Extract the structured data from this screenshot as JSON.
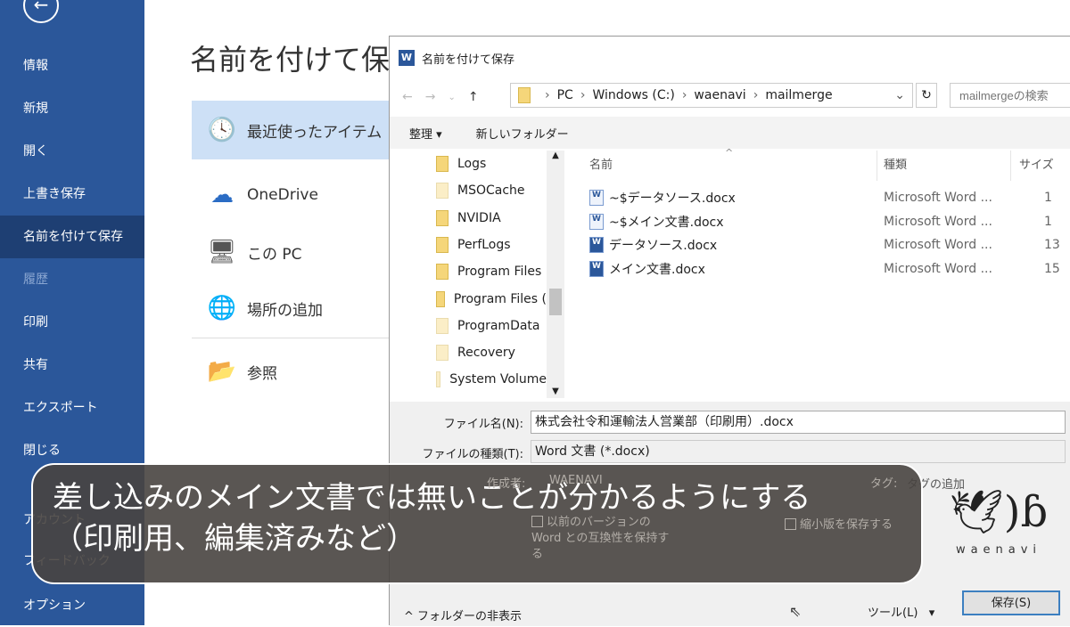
{
  "backstage": {
    "nav": [
      {
        "label": "情報"
      },
      {
        "label": "新規"
      },
      {
        "label": "開く"
      },
      {
        "label": "上書き保存"
      },
      {
        "label": "名前を付けて保存",
        "selected": true
      },
      {
        "label": "履歴",
        "disabled": true
      },
      {
        "label": "印刷"
      },
      {
        "label": "共有"
      },
      {
        "label": "エクスポート"
      },
      {
        "label": "閉じる"
      },
      {
        "label": "アカウント"
      },
      {
        "label": "フィードバック"
      },
      {
        "label": "オプション"
      }
    ],
    "title": "名前を付けて保存",
    "locations": [
      {
        "label": "最近使ったアイテム",
        "icon": "clock-icon"
      },
      {
        "label": "OneDrive",
        "icon": "cloud-icon"
      },
      {
        "label": "この PC",
        "icon": "computer-icon"
      },
      {
        "label": "場所の追加",
        "icon": "globe-add-icon"
      },
      {
        "label": "参照",
        "icon": "folder-open-icon"
      }
    ]
  },
  "dialog": {
    "title": "名前を付けて保存",
    "breadcrumb": [
      "PC",
      "Windows (C:)",
      "waenavi",
      "mailmerge"
    ],
    "search_placeholder": "mailmergeの検索",
    "toolbar": {
      "organize": "整理 ▾",
      "new_folder": "新しいフォルダー"
    },
    "tree": [
      {
        "name": "Logs"
      },
      {
        "name": "MSOCache",
        "pale": true
      },
      {
        "name": "NVIDIA"
      },
      {
        "name": "PerfLogs"
      },
      {
        "name": "Program Files"
      },
      {
        "name": "Program Files ("
      },
      {
        "name": "ProgramData",
        "pale": true
      },
      {
        "name": "Recovery",
        "pale": true
      },
      {
        "name": "System Volume",
        "pale": true
      }
    ],
    "columns": {
      "name": "名前",
      "type": "種類",
      "size": "サイズ"
    },
    "files": [
      {
        "name": "~$データソース.docx",
        "type": "Microsoft Word ...",
        "size": "1",
        "temp": true
      },
      {
        "name": "~$メイン文書.docx",
        "type": "Microsoft Word ...",
        "size": "1",
        "temp": true
      },
      {
        "name": "データソース.docx",
        "type": "Microsoft Word ...",
        "size": "13"
      },
      {
        "name": "メイン文書.docx",
        "type": "Microsoft Word ...",
        "size": "15"
      }
    ],
    "filename_label": "ファイル名(N):",
    "filename_value": "株式会社令和運輸法人営業部（印刷用）.docx",
    "filetype_label": "ファイルの種類(T):",
    "filetype_value": "Word 文書 (*.docx)",
    "author_label": "作成者:",
    "author_value": "WAENAVI",
    "tags_label": "タグ:",
    "tags_value": "タグの追加",
    "compat_checkbox": "以前のバージョンの Word との互換性を保持する",
    "thumbnail_checkbox": "縮小版を保存する",
    "hide_folders": "^ フォルダーの非表示",
    "tools": "ツール(L)",
    "save": "保存(S)"
  },
  "caption": {
    "line1": "差し込みのメイン文書では無いことが分かるようにする",
    "line2": "（印刷用、編集済みなど）"
  },
  "logo": {
    "text": "waenavi"
  },
  "colors": {
    "sidebar": "#2b579a",
    "selected_location": "#cde0f6"
  }
}
